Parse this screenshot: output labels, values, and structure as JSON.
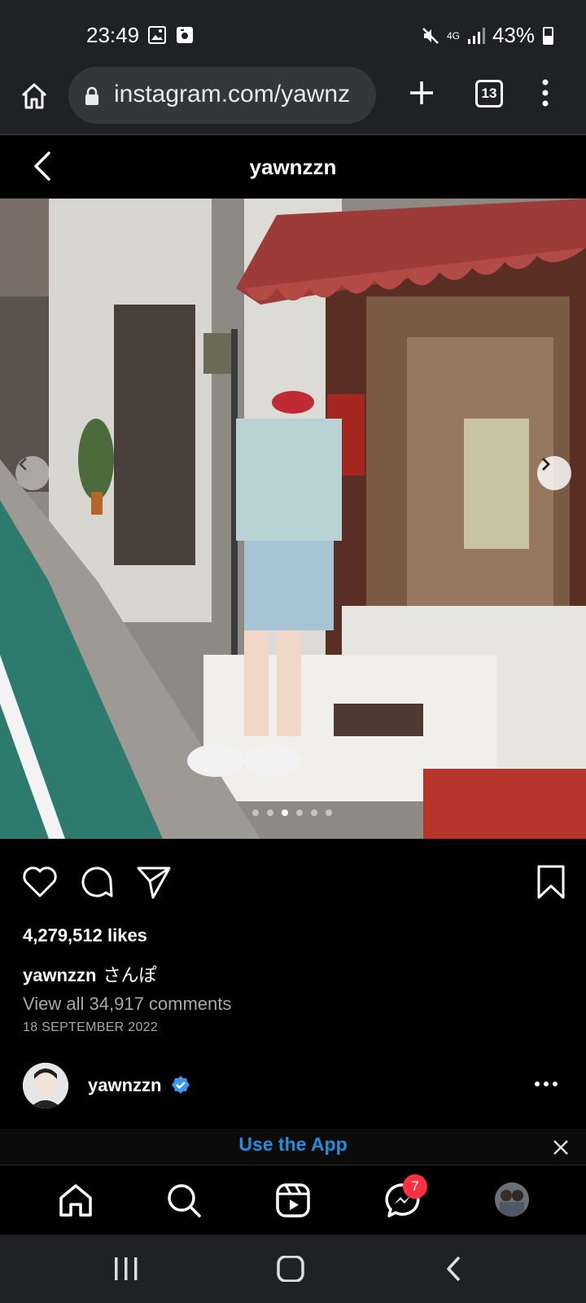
{
  "status_bar": {
    "time": "23:49",
    "network": "4G",
    "battery": "43%"
  },
  "browser": {
    "url": "instagram.com/yawnz",
    "tab_count": "13"
  },
  "header": {
    "title": "yawnzzn"
  },
  "post": {
    "carousel_total": 6,
    "carousel_current": 3,
    "likes": "4,279,512 likes",
    "caption_user": "yawnzzn",
    "caption_text": "さんぽ",
    "view_comments": "View all 34,917 comments",
    "date": "18 SEPTEMBER 2022",
    "author": "yawnzzn"
  },
  "banner": {
    "label": "Use the App"
  },
  "bottom_nav": {
    "messages_badge": "7"
  },
  "colors": {
    "link_blue": "#1f8fe0",
    "badge_red": "#ff3040",
    "verified_blue": "#3897f0"
  }
}
